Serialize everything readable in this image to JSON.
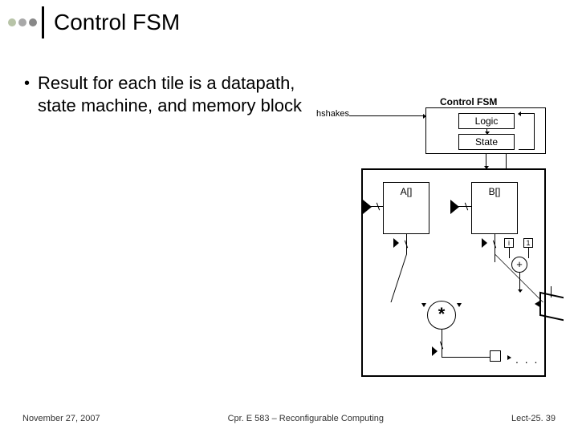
{
  "title": "Control FSM",
  "bullet": {
    "text": "Result for each tile is a datapath, state machine, and memory block"
  },
  "diagram": {
    "fsm_title": "Control FSM",
    "logic": "Logic",
    "state": "State",
    "handshake": "hshakes",
    "memA": "A[]",
    "memB": "B[]",
    "i": "i",
    "one": "1",
    "plus": "+",
    "mul": "*",
    "dots": ". . ."
  },
  "footer": {
    "left": "November 27, 2007",
    "center": "Cpr. E 583 – Reconfigurable Computing",
    "right": "Lect-25. 39"
  }
}
